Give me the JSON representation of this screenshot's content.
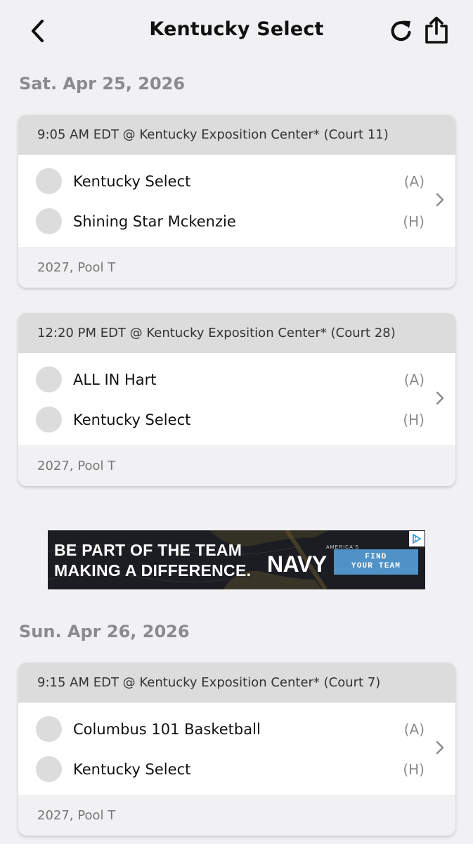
{
  "header": {
    "title": "Kentucky Select",
    "back_icon": "chevron-left-icon",
    "refresh_icon": "refresh-icon",
    "share_icon": "share-icon"
  },
  "days": [
    {
      "date": "Sat. Apr 25, 2026",
      "games": [
        {
          "info": "9:05 AM EDT @ Kentucky Exposition Center* (Court 11)",
          "teams": [
            {
              "name": "Kentucky Select",
              "side": "(A)"
            },
            {
              "name": "Shining Star Mckenzie",
              "side": "(H)"
            }
          ],
          "division": "2027, Pool T"
        },
        {
          "info": "12:20 PM EDT @ Kentucky Exposition Center* (Court 28)",
          "teams": [
            {
              "name": "ALL IN Hart",
              "side": "(A)"
            },
            {
              "name": "Kentucky Select",
              "side": "(H)"
            }
          ],
          "division": "2027, Pool T"
        }
      ]
    },
    {
      "date": "Sun. Apr 26, 2026",
      "games": [
        {
          "info": "9:15 AM EDT @ Kentucky Exposition Center* (Court 7)",
          "teams": [
            {
              "name": "Columbus 101 Basketball",
              "side": "(A)"
            },
            {
              "name": "Kentucky Select",
              "side": "(H)"
            }
          ],
          "division": "2027, Pool T"
        }
      ]
    }
  ],
  "ad": {
    "headline_line1": "BE PART OF THE TEAM",
    "headline_line2": "MAKING A DIFFERENCE.",
    "brand_small": "AMERICA'S",
    "brand": "NAVY",
    "cta_line1": "FIND",
    "cta_line2": "YOUR TEAM",
    "adchoices_icon": "adchoices-icon"
  },
  "colors": {
    "background": "#f1f1f3",
    "card_header": "#dcdcdc",
    "muted_text": "#8a8a8f",
    "ad_cta": "#4f92c8"
  }
}
